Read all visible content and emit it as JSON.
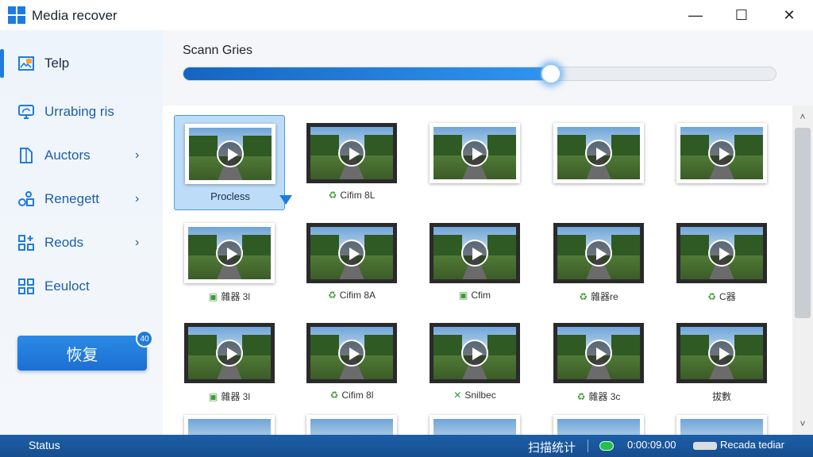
{
  "window": {
    "title": "Media recover",
    "minimize_label": "—",
    "maximize_label": "☐",
    "close_label": "✕"
  },
  "sidebar": {
    "items": [
      {
        "label": "Telp",
        "icon": "image-folder-icon",
        "active": true,
        "chevron": ""
      },
      {
        "label": "Urrabing ris",
        "icon": "cloud-monitor-icon",
        "active": false,
        "chevron": ""
      },
      {
        "label": "Auctors",
        "icon": "document-icon",
        "active": false,
        "chevron": "›"
      },
      {
        "label": "Renegett",
        "icon": "shapes-icon",
        "active": false,
        "chevron": "›"
      },
      {
        "label": "Reods",
        "icon": "grid-sparkle-icon",
        "active": false,
        "chevron": "›"
      },
      {
        "label": "Eeuloct",
        "icon": "apps-grid-icon",
        "active": false,
        "chevron": ""
      }
    ],
    "restore_button": "恢复",
    "restore_badge": "40"
  },
  "scan": {
    "label": "Scann Gries",
    "progress_percent": 62
  },
  "grid": {
    "tiles": [
      {
        "caption": "Procless",
        "mark": "",
        "selected": true
      },
      {
        "caption": "Cifim 8L",
        "mark": "♻",
        "selected": false
      },
      {
        "caption": "",
        "mark": "",
        "selected": false
      },
      {
        "caption": "",
        "mark": "",
        "selected": false
      },
      {
        "caption": "",
        "mark": "",
        "selected": false
      },
      {
        "caption": "雜器 3l",
        "mark": "▣",
        "selected": false
      },
      {
        "caption": "Cifim 8A",
        "mark": "♻",
        "selected": false
      },
      {
        "caption": "Cfim",
        "mark": "▣",
        "selected": false
      },
      {
        "caption": "雜器re",
        "mark": "♻",
        "selected": false
      },
      {
        "caption": "C器",
        "mark": "♻",
        "selected": false
      },
      {
        "caption": "雜器 3l",
        "mark": "▣",
        "selected": false
      },
      {
        "caption": "Cifim 8l",
        "mark": "♻",
        "selected": false
      },
      {
        "caption": "Snilbec",
        "mark": "✕",
        "selected": false
      },
      {
        "caption": "雜器 3c",
        "mark": "♻",
        "selected": false
      },
      {
        "caption": "拔數",
        "mark": "",
        "selected": false
      }
    ]
  },
  "scrollbar": {
    "up": "˄",
    "down": "˅"
  },
  "statusbar": {
    "status": "Status",
    "scan_stats": "扫描统计",
    "elapsed": "0:00:09.00",
    "drive_label": "Recada tediar"
  },
  "colors": {
    "accent": "#1e7be0",
    "statusbar": "#1c5ea8",
    "sidebar_text": "#1d5fa8"
  }
}
